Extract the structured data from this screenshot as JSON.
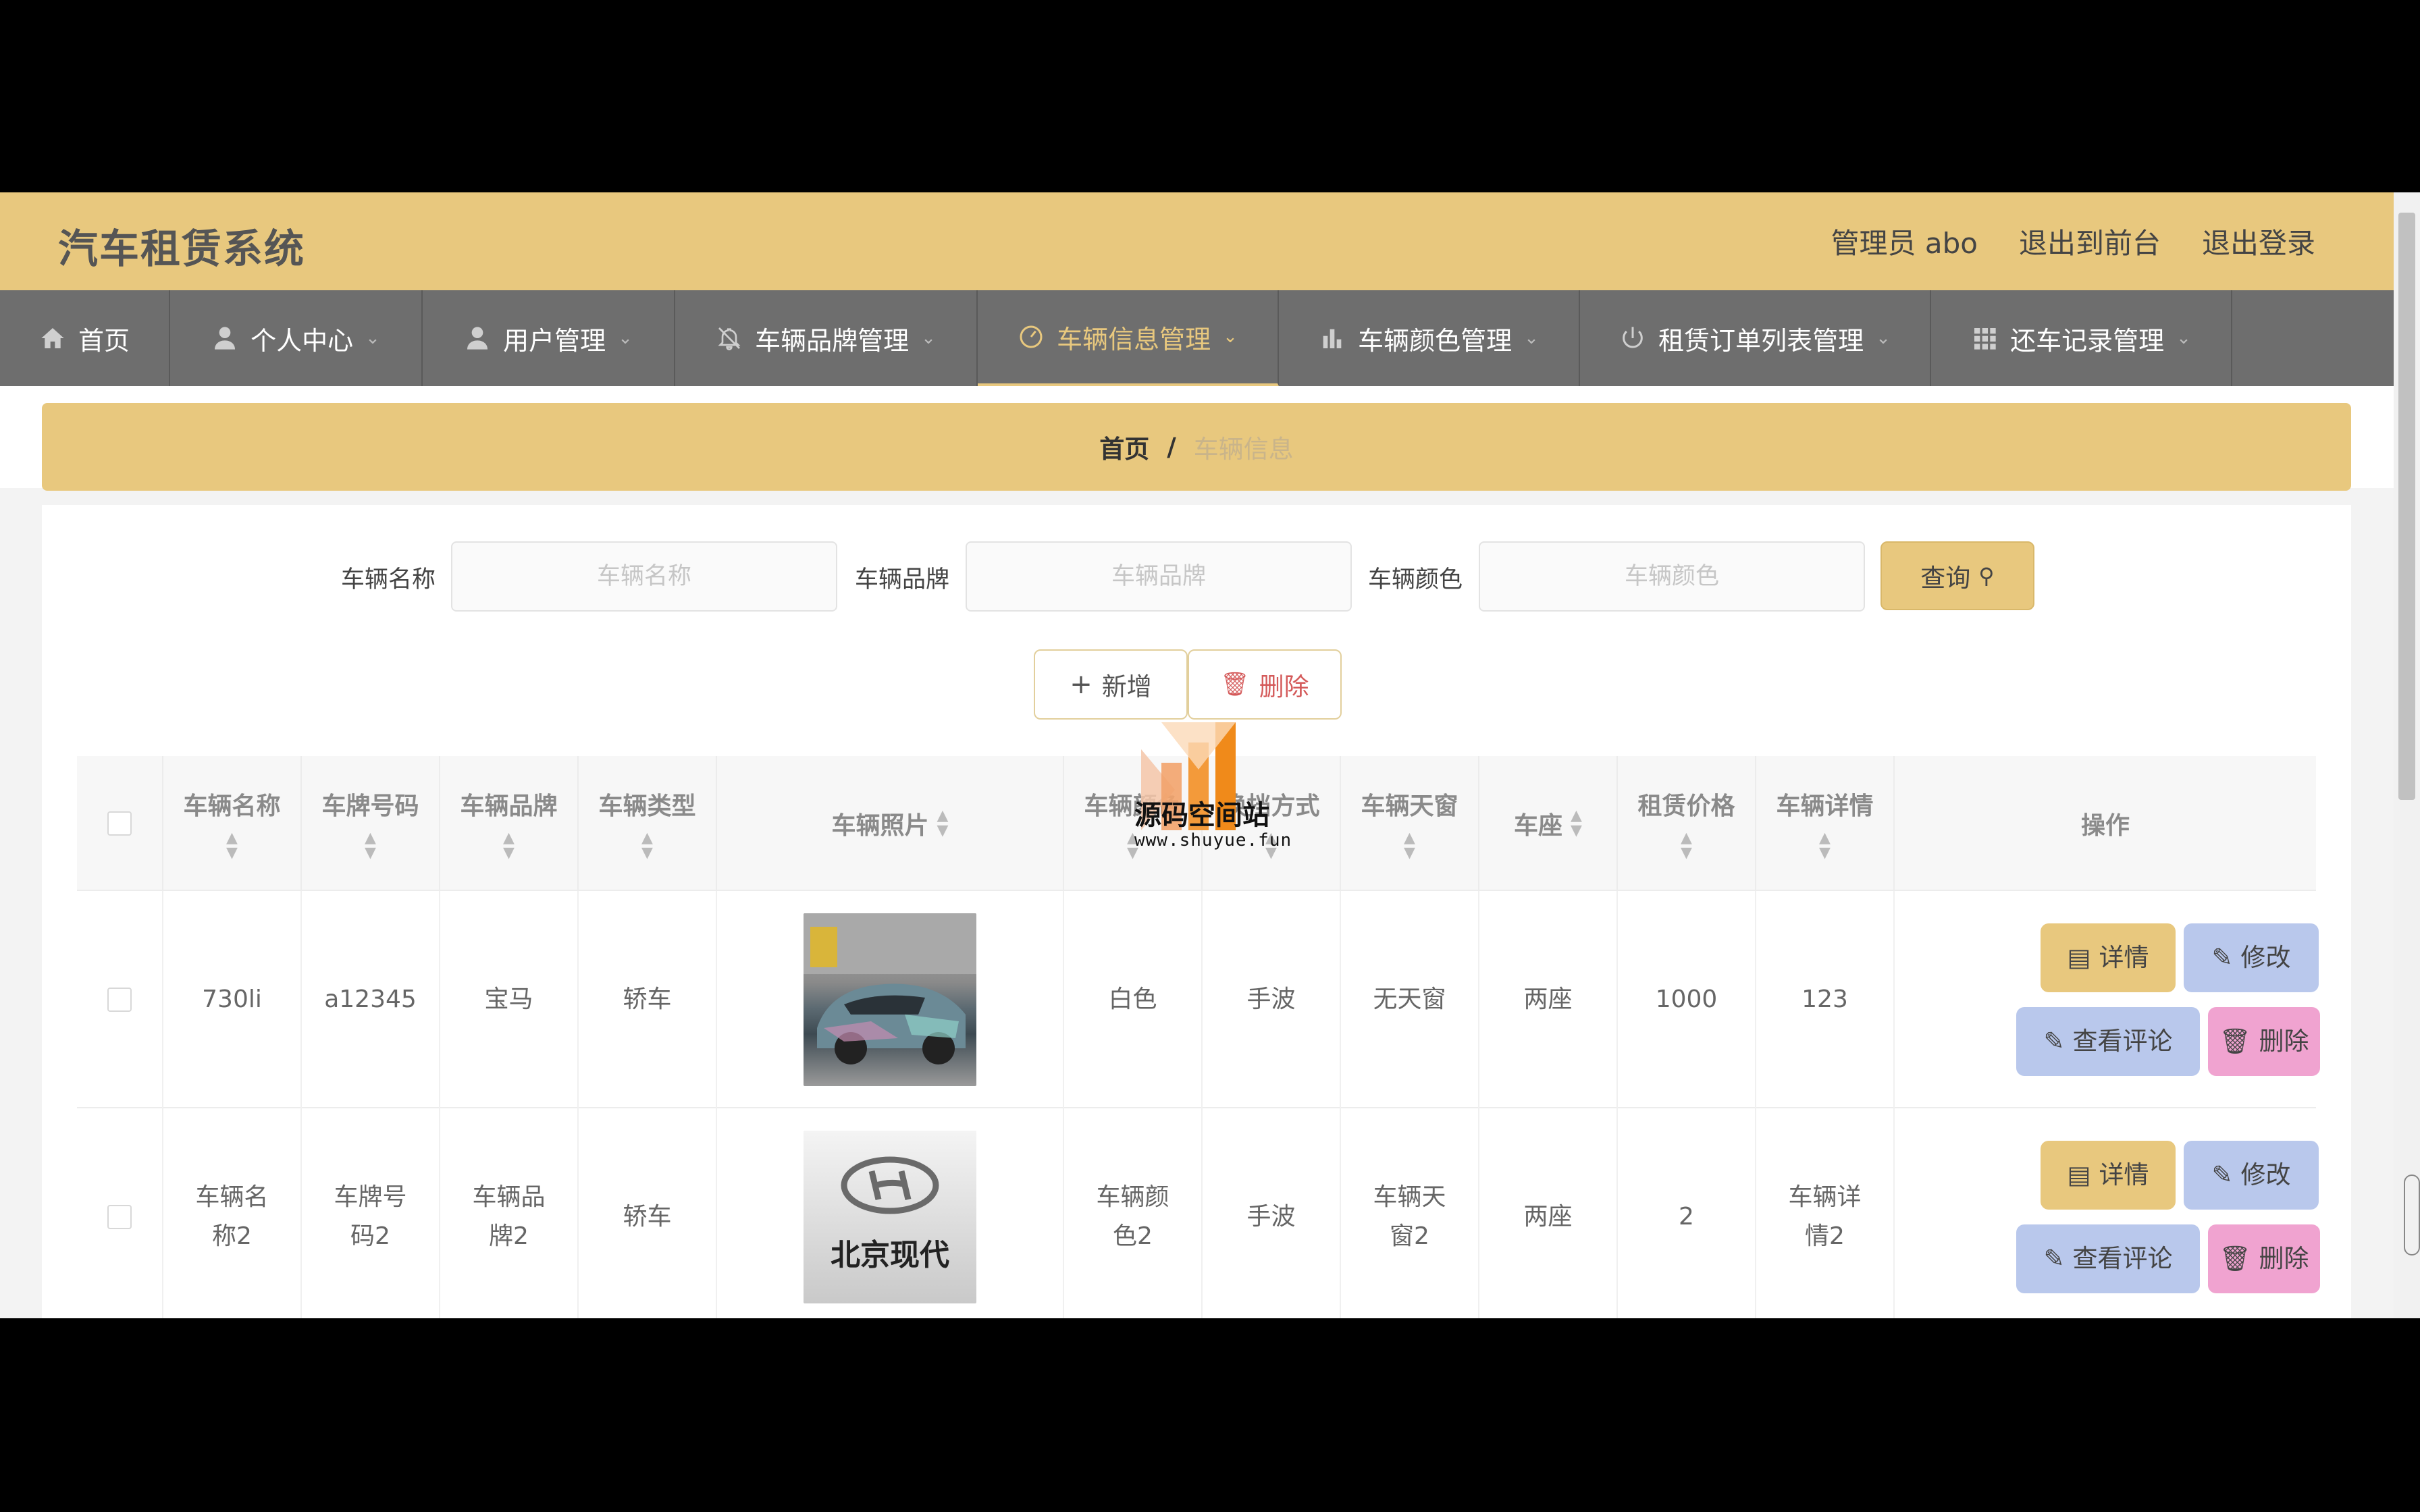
{
  "header": {
    "title": "汽车租赁系统",
    "admin": "管理员 abo",
    "back_to_front": "退出到前台",
    "logout": "退出登录"
  },
  "nav": [
    {
      "label": "首页",
      "icon": "home-icon",
      "active": false
    },
    {
      "label": "个人中心",
      "icon": "user-icon",
      "active": false
    },
    {
      "label": "用户管理",
      "icon": "user-icon",
      "active": false
    },
    {
      "label": "车辆品牌管理",
      "icon": "bell-off-icon",
      "active": false
    },
    {
      "label": "车辆信息管理",
      "icon": "dashboard-icon",
      "active": true
    },
    {
      "label": "车辆颜色管理",
      "icon": "bar-chart-icon",
      "active": false
    },
    {
      "label": "租赁订单列表管理",
      "icon": "power-icon",
      "active": false
    },
    {
      "label": "还车记录管理",
      "icon": "grid-icon",
      "active": false
    }
  ],
  "breadcrumb": {
    "home": "首页",
    "separator": "/",
    "current": "车辆信息"
  },
  "search": {
    "name_label": "车辆名称",
    "name_placeholder": "车辆名称",
    "brand_label": "车辆品牌",
    "brand_placeholder": "车辆品牌",
    "color_label": "车辆颜色",
    "color_placeholder": "车辆颜色",
    "button": "查询"
  },
  "actions": {
    "add": "新增",
    "delete": "删除"
  },
  "table": {
    "headers": [
      "车辆名称",
      "车牌号码",
      "车辆品牌",
      "车辆类型",
      "车辆照片",
      "车辆颜色",
      "换挡方式",
      "车辆天窗",
      "车座",
      "租赁价格",
      "车辆详情",
      "操作"
    ],
    "rows": [
      {
        "name": "730li",
        "plate": "a12345",
        "brand": "宝马",
        "type": "轿车",
        "photo": "car-photo",
        "color": "白色",
        "gear": "手波",
        "sunroof": "无天窗",
        "seats": "两座",
        "price": "1000",
        "detail": "123"
      },
      {
        "name": "车辆名称2",
        "plate": "车牌号码2",
        "brand": "车辆品牌2",
        "type": "轿车",
        "photo": "hyundai-logo",
        "photo_text": "北京现代",
        "color": "车辆颜色2",
        "gear": "手波",
        "sunroof": "车辆天窗2",
        "seats": "两座",
        "price": "2",
        "detail": "车辆详情2"
      }
    ],
    "op_buttons": {
      "detail": "详情",
      "edit": "修改",
      "review": "查看评论",
      "delete": "删除"
    }
  },
  "watermark": {
    "text": "源码空间站",
    "url": "www.shuyue.fun"
  },
  "colors": {
    "accent": "#e8c87e",
    "nav_bg": "#6e6e6e",
    "edit_btn": "#b9c8ec",
    "delete_btn": "#f0a3d0"
  }
}
